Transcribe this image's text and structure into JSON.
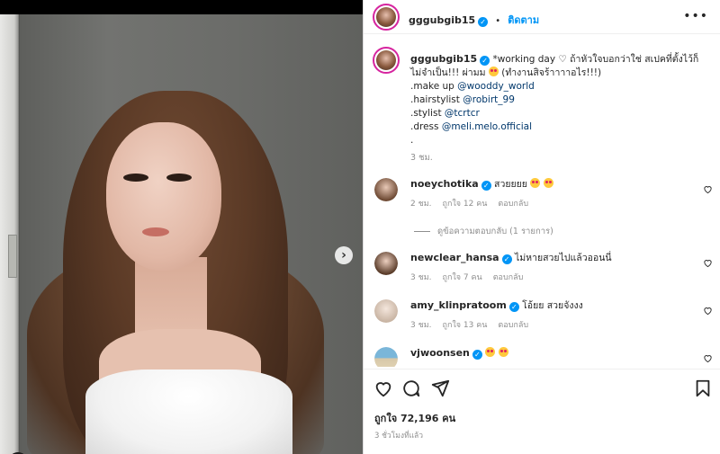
{
  "post": {
    "username": "gggubgib15",
    "follow_label": "ติดตาม",
    "more_label": "•••"
  },
  "caption": {
    "username": "gggubgib15",
    "text_line1": "*working day ♡ ถ้าหัวใจบอกว่าใช่ สเปคที่ตั้งไว้ก็ไม่จำเป็น!!! ผ่ามม",
    "text_line1_tail": "(ทำงานสิจร้าาาาอไร!!!)",
    "makeup_prefix": ".make up",
    "makeup_link": "@wooddy_world",
    "hair_prefix": ".hairstylist",
    "hair_link": "@robirt_99",
    "stylist_prefix": ".stylist",
    "stylist_link": "@tcrtcr",
    "dress_prefix": ".dress",
    "dress_link": "@meli.melo.official",
    "dot": ".",
    "time": "3 ชม."
  },
  "comments": [
    {
      "username": "noeychotika",
      "text": "สวยยยย",
      "time": "2 ชม.",
      "likes": "ถูกใจ 12 คน",
      "reply": "ตอบกลับ",
      "emoji_count": 2
    },
    {
      "username": "newclear_hansa",
      "text": "ไม่หายสวยไปแล้วออนนี่",
      "time": "3 ชม.",
      "likes": "ถูกใจ 7 คน",
      "reply": "ตอบกลับ",
      "emoji_count": 0
    },
    {
      "username": "amy_klinpratoom",
      "text": "โอ้ยย สวยจังงง",
      "time": "3 ชม.",
      "likes": "ถูกใจ 13 คน",
      "reply": "ตอบกลับ",
      "emoji_count": 0
    },
    {
      "username": "vjwoonsen",
      "text": "",
      "time": "",
      "likes": "",
      "reply": "",
      "emoji_count": 2
    }
  ],
  "view_replies": "ดูข้อความตอบกลับ (1 รายการ)",
  "footer": {
    "likes": "ถูกใจ 72,196 คน",
    "time": "3 ชั่วโมงที่แล้ว"
  },
  "icons": {
    "next": "chevron-right-icon",
    "tag": "user-tag-icon",
    "heart": "heart-icon",
    "comment": "comment-icon",
    "share": "share-icon",
    "save": "bookmark-icon"
  },
  "colors": {
    "link": "#00376b",
    "follow": "#0095f6",
    "verified": "#0095f6",
    "meta": "#8e8e8e"
  }
}
